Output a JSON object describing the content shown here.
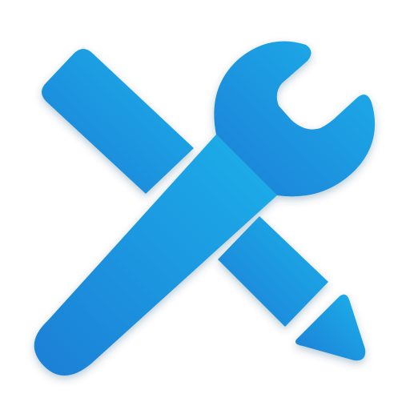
{
  "icon": {
    "name": "tools-icon",
    "description_parts": [
      "pencil-icon",
      "wrench-icon"
    ],
    "colors": {
      "gradient_start": "#1E7FD6",
      "gradient_end": "#1AB0EA",
      "background": "#FFFFFF",
      "shadow": "#0B3F6B"
    }
  }
}
